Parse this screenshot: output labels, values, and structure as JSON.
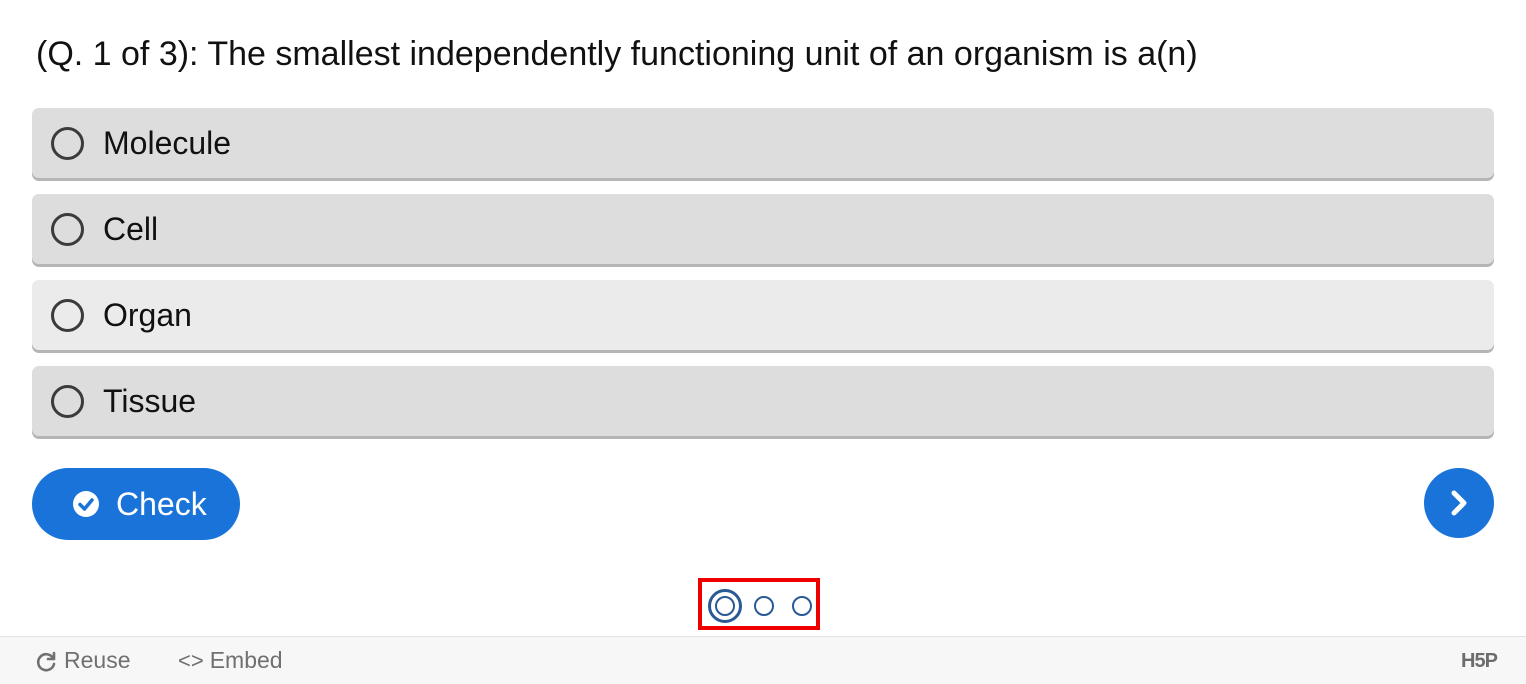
{
  "question": {
    "text": "(Q. 1 of 3): The smallest independently functioning unit of an organism is a(n)"
  },
  "answers": [
    {
      "label": "Molecule"
    },
    {
      "label": "Cell"
    },
    {
      "label": "Organ"
    },
    {
      "label": "Tissue"
    }
  ],
  "actions": {
    "check_label": "Check",
    "check_icon": "check-circle-icon",
    "next_icon": "chevron-right-icon"
  },
  "progress": {
    "current": 1,
    "total": 3
  },
  "footer": {
    "reuse_label": "Reuse",
    "embed_label": "Embed",
    "embed_glyph": "<>",
    "logo_text": "H5P"
  },
  "colors": {
    "accent": "#1a73d9",
    "answer_bg": "#dddddd",
    "answer_hover_bg": "#ebebeb",
    "dot": "#2a5a95",
    "highlight_box": "#ee0000"
  }
}
